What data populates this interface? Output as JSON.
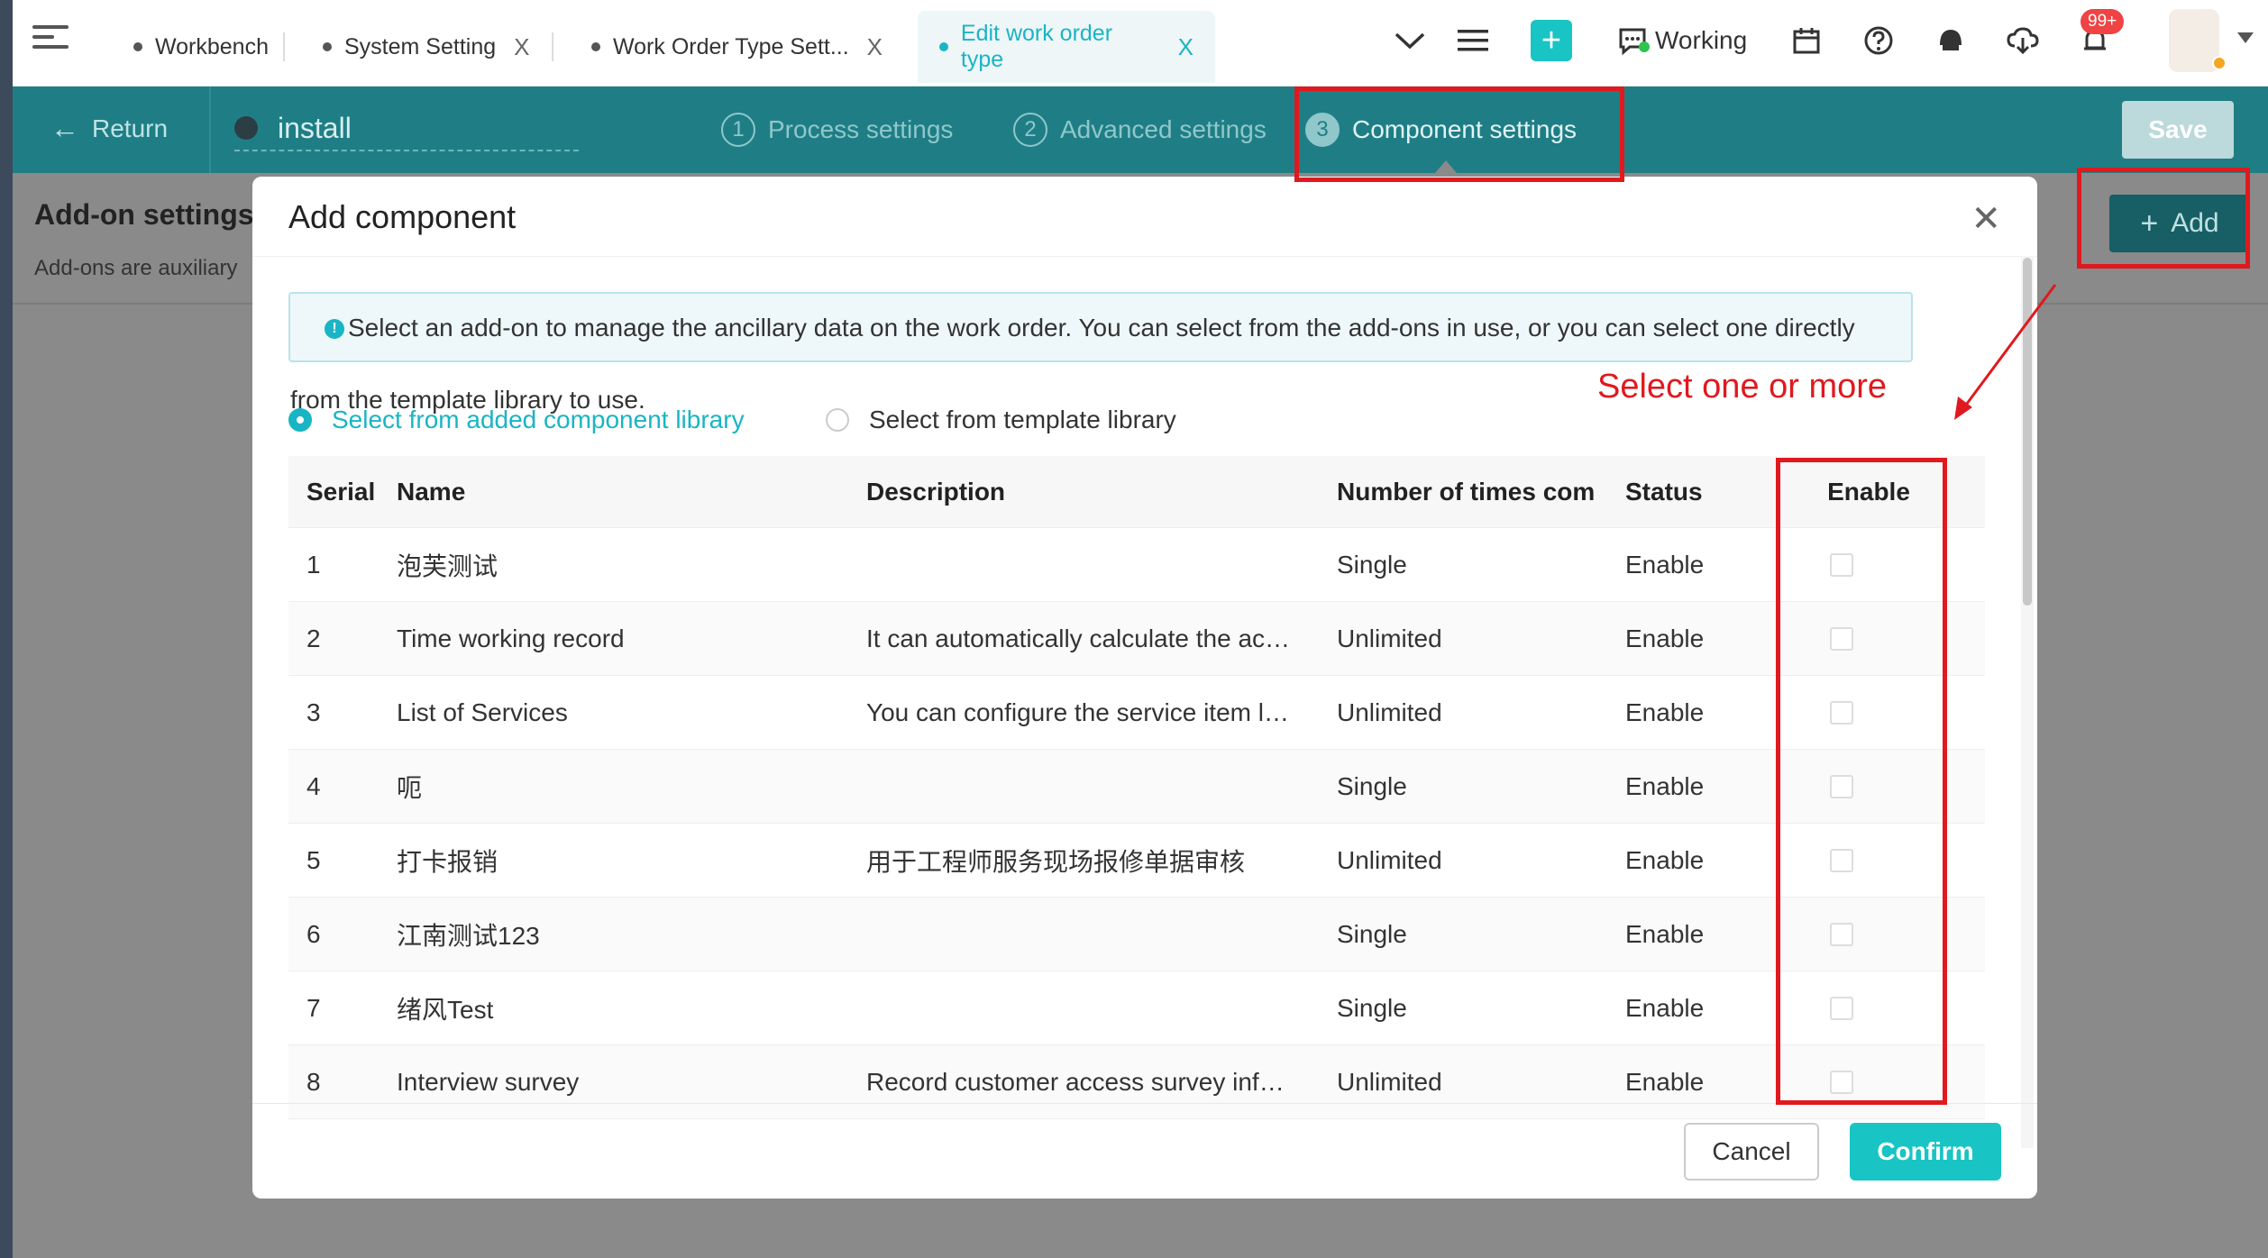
{
  "tabs": [
    {
      "label": "Workbench",
      "closable": false
    },
    {
      "label": "System Setting",
      "closable": true
    },
    {
      "label": "Work Order Type Sett...",
      "closable": true
    },
    {
      "label": "Edit work order type",
      "closable": true,
      "active": true
    }
  ],
  "topbar": {
    "status_label": "Working",
    "notification_badge": "99+",
    "close_glyph": "X"
  },
  "header": {
    "return_label": "Return",
    "form_name": "install",
    "steps": [
      {
        "num": "1",
        "label": "Process settings"
      },
      {
        "num": "2",
        "label": "Advanced settings"
      },
      {
        "num": "3",
        "label": "Component settings",
        "active": true
      }
    ],
    "save_label": "Save"
  },
  "background": {
    "title": "Add-on settings",
    "subtitle": "Add-ons are auxiliary",
    "add_label": "Add"
  },
  "modal": {
    "title": "Add component",
    "info_line1": "Select an add-on to manage the ancillary data on the work order. You can select from the add-ons in use, or you can select one directly",
    "info_line2": "from the template library to use.",
    "radio_added": "Select from added component library",
    "radio_template": "Select from template library",
    "columns": {
      "serial": "Serial",
      "name": "Name",
      "description": "Description",
      "times": "Number of times com",
      "status": "Status",
      "enable": "Enable"
    },
    "rows": [
      {
        "serial": "1",
        "name": "泡芙测试",
        "description": "",
        "times": "Single",
        "status": "Enable"
      },
      {
        "serial": "2",
        "name": "Time working record",
        "description": "It can automatically calculate the ac…",
        "times": "Unlimited",
        "status": "Enable"
      },
      {
        "serial": "3",
        "name": "List of Services",
        "description": "You can configure the service item l…",
        "times": "Unlimited",
        "status": "Enable"
      },
      {
        "serial": "4",
        "name": "呃",
        "description": "",
        "times": "Single",
        "status": "Enable"
      },
      {
        "serial": "5",
        "name": "打卡报销",
        "description": "用于工程师服务现场报修单据审核",
        "times": "Unlimited",
        "status": "Enable"
      },
      {
        "serial": "6",
        "name": "江南测试123",
        "description": "",
        "times": "Single",
        "status": "Enable"
      },
      {
        "serial": "7",
        "name": "绪风Test",
        "description": "",
        "times": "Single",
        "status": "Enable"
      },
      {
        "serial": "8",
        "name": "Interview survey",
        "description": "Record customer access survey inf…",
        "times": "Unlimited",
        "status": "Enable"
      }
    ],
    "cancel_label": "Cancel",
    "confirm_label": "Confirm"
  },
  "annotation": {
    "text": "Select one or more",
    "color": "#e0191e"
  },
  "colors": {
    "accent": "#19c4c4",
    "header_bg": "#1f7e85"
  }
}
